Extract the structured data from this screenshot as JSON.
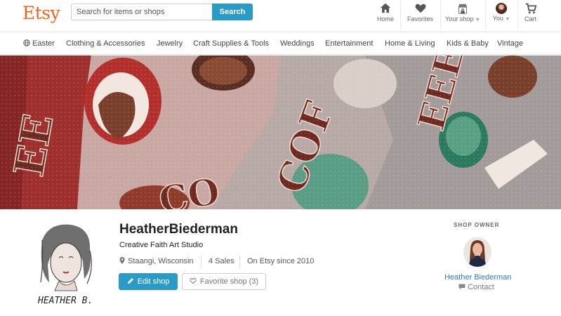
{
  "brand": {
    "logo": "Etsy",
    "accent": "#f1641e",
    "button_blue": "#2a9bc6"
  },
  "search": {
    "placeholder": "Search for items or shops",
    "button_label": "Search"
  },
  "nav": {
    "home": {
      "label": "Home",
      "icon": "home-icon"
    },
    "favorites": {
      "label": "Favorites",
      "icon": "heart-icon"
    },
    "your_shop": {
      "label": "Your shop",
      "icon": "shop-icon"
    },
    "you": {
      "label": "You",
      "icon": "avatar"
    },
    "cart": {
      "label": "Cart",
      "icon": "cart-icon"
    }
  },
  "categories": [
    "Easter",
    "Clothing & Accessories",
    "Jewelry",
    "Craft Supplies & Tools",
    "Weddings",
    "Entertainment",
    "Home & Living",
    "Kids & Baby",
    "Vintage"
  ],
  "shop": {
    "name": "HeatherBiederman",
    "title": "Creative Faith Art Studio",
    "location": "Staangi, Wisconsin",
    "sales": "4 Sales",
    "since": "On Etsy since 2010",
    "edit_label": "Edit shop",
    "favorite_label": "Favorite shop (3)",
    "signature": "HEATHER B."
  },
  "owner": {
    "section_label": "SHOP OWNER",
    "name": "Heather Biederman",
    "contact_label": "Contact"
  },
  "banner": {
    "fabric_text": "COFFEE"
  }
}
